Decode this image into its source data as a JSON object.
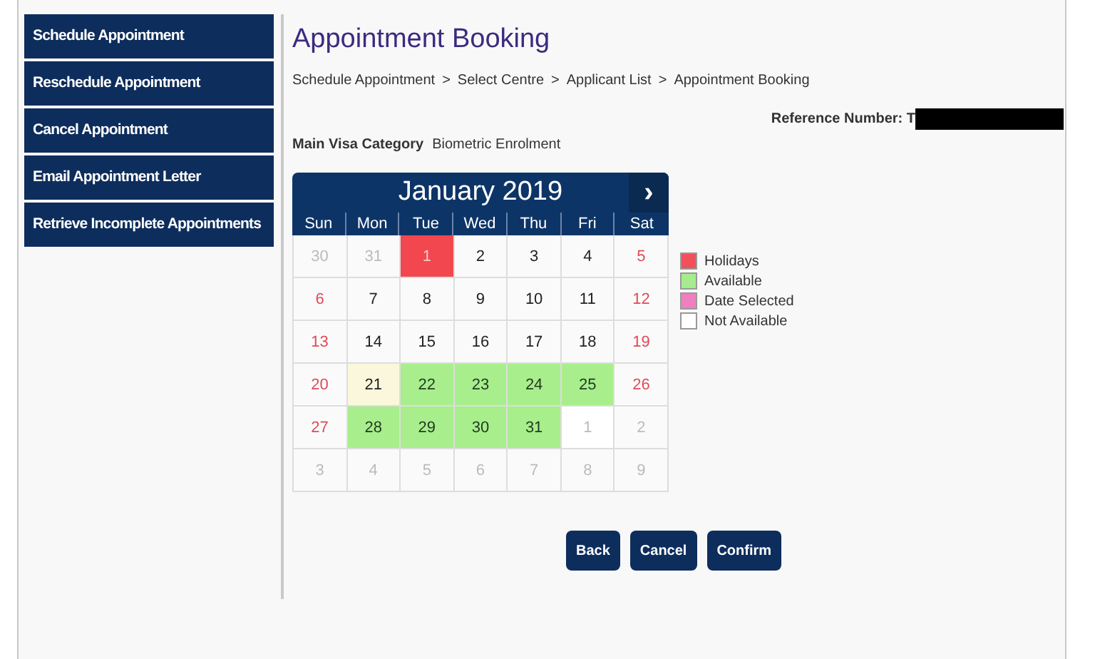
{
  "sidebar": {
    "items": [
      {
        "label": "Schedule Appointment"
      },
      {
        "label": "Reschedule Appointment"
      },
      {
        "label": "Cancel Appointment"
      },
      {
        "label": "Email Appointment Letter"
      },
      {
        "label": "Retrieve Incomplete Appointments"
      }
    ]
  },
  "title": "Appointment Booking",
  "breadcrumb": [
    "Schedule Appointment",
    "Select Centre",
    "Applicant List",
    "Appointment Booking"
  ],
  "breadcrumb_separator": ">",
  "reference": {
    "label": "Reference Number: T"
  },
  "visa_category": {
    "label": "Main Visa Category",
    "value": "Biometric Enrolment"
  },
  "calendar": {
    "month": "January 2019",
    "next": "›",
    "weekdays": [
      "Sun",
      "Mon",
      "Tue",
      "Wed",
      "Thu",
      "Fri",
      "Sat"
    ],
    "weeks": [
      [
        {
          "day": "30",
          "kind": "other"
        },
        {
          "day": "31",
          "kind": "other"
        },
        {
          "day": "1",
          "kind": "holiday"
        },
        {
          "day": "2",
          "kind": "normal"
        },
        {
          "day": "3",
          "kind": "normal"
        },
        {
          "day": "4",
          "kind": "normal"
        },
        {
          "day": "5",
          "kind": "weekend"
        }
      ],
      [
        {
          "day": "6",
          "kind": "weekend"
        },
        {
          "day": "7",
          "kind": "normal"
        },
        {
          "day": "8",
          "kind": "normal"
        },
        {
          "day": "9",
          "kind": "normal"
        },
        {
          "day": "10",
          "kind": "normal"
        },
        {
          "day": "11",
          "kind": "normal"
        },
        {
          "day": "12",
          "kind": "weekend"
        }
      ],
      [
        {
          "day": "13",
          "kind": "weekend"
        },
        {
          "day": "14",
          "kind": "normal"
        },
        {
          "day": "15",
          "kind": "normal"
        },
        {
          "day": "16",
          "kind": "normal"
        },
        {
          "day": "17",
          "kind": "normal"
        },
        {
          "day": "18",
          "kind": "normal"
        },
        {
          "day": "19",
          "kind": "weekend"
        }
      ],
      [
        {
          "day": "20",
          "kind": "weekend"
        },
        {
          "day": "21",
          "kind": "today"
        },
        {
          "day": "22",
          "kind": "available"
        },
        {
          "day": "23",
          "kind": "available"
        },
        {
          "day": "24",
          "kind": "available"
        },
        {
          "day": "25",
          "kind": "available"
        },
        {
          "day": "26",
          "kind": "weekend"
        }
      ],
      [
        {
          "day": "27",
          "kind": "weekend"
        },
        {
          "day": "28",
          "kind": "available"
        },
        {
          "day": "29",
          "kind": "available"
        },
        {
          "day": "30",
          "kind": "available"
        },
        {
          "day": "31",
          "kind": "available"
        },
        {
          "day": "1",
          "kind": "next"
        },
        {
          "day": "2",
          "kind": "other"
        }
      ],
      [
        {
          "day": "3",
          "kind": "other"
        },
        {
          "day": "4",
          "kind": "other"
        },
        {
          "day": "5",
          "kind": "other"
        },
        {
          "day": "6",
          "kind": "other"
        },
        {
          "day": "7",
          "kind": "other"
        },
        {
          "day": "8",
          "kind": "other"
        },
        {
          "day": "9",
          "kind": "other"
        }
      ]
    ]
  },
  "legend": [
    {
      "label": "Holidays",
      "color": "#f0505a"
    },
    {
      "label": "Available",
      "color": "#a6ec8e"
    },
    {
      "label": "Date Selected",
      "color": "#f07fc0"
    },
    {
      "label": "Not Available",
      "color": "#ffffff"
    }
  ],
  "buttons": [
    "Back",
    "Cancel",
    "Confirm"
  ]
}
